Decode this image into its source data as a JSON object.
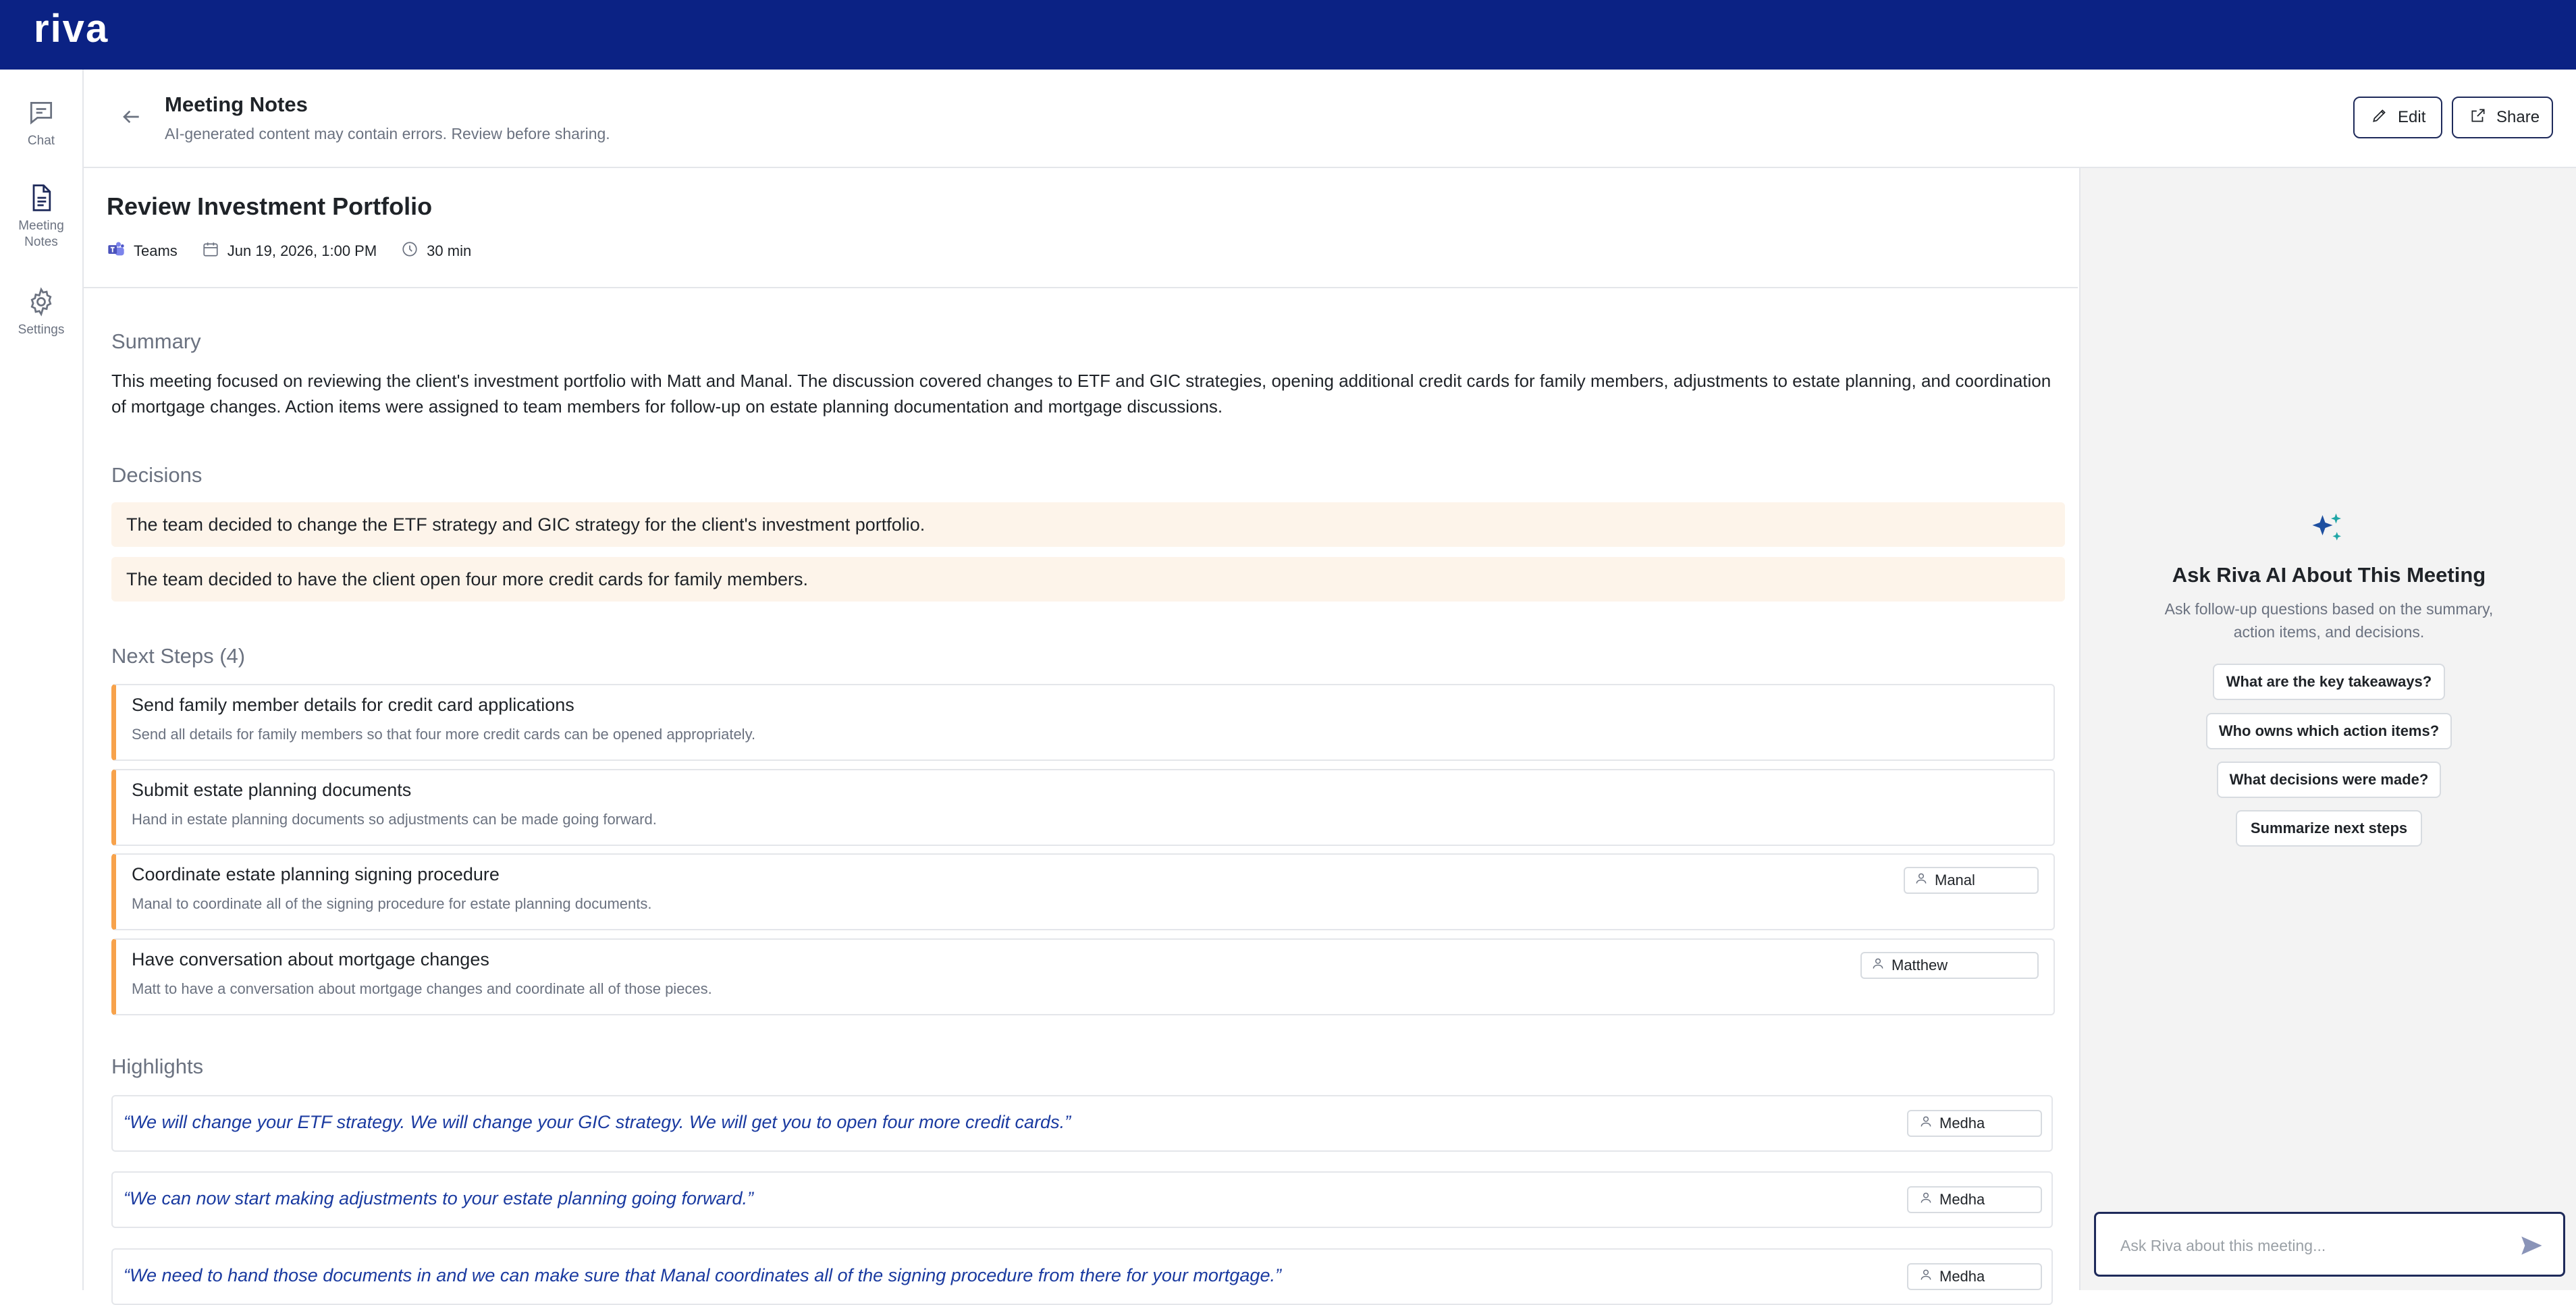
{
  "brand": {
    "logo_text": "riva",
    "bar_color": "#0b2284"
  },
  "sidebar": {
    "items": [
      {
        "label": "Chat",
        "icon": "chat-icon"
      },
      {
        "label": "Meeting Notes",
        "icon": "document-icon"
      },
      {
        "label": "Settings",
        "icon": "gear-icon"
      }
    ]
  },
  "header": {
    "title": "Meeting Notes",
    "subtitle": "AI-generated content may contain errors. Review before sharing.",
    "edit_label": "Edit",
    "share_label": "Share"
  },
  "meeting": {
    "title": "Review Investment Portfolio",
    "platform": "Teams",
    "date": "Jun 19, 2026, 1:00 PM",
    "duration": "30 min"
  },
  "summary": {
    "title": "Summary",
    "text": "This meeting focused on reviewing the client's investment portfolio with Matt and Manal. The discussion covered changes to ETF and GIC strategies, opening additional credit cards for family members, adjustments to estate planning, and coordination of mortgage changes. Action items were assigned to team members for follow-up on estate planning documentation and mortgage discussions."
  },
  "decisions": {
    "title": "Decisions",
    "items": [
      "The team decided to change the ETF strategy and GIC strategy for the client's investment portfolio.",
      "The team decided to have the client open four more credit cards for family members."
    ]
  },
  "next_steps": {
    "title": "Next Steps (4)",
    "items": [
      {
        "title": "Send family member details for credit card applications",
        "desc": "Send all details for family members so that four more credit cards can be opened appropriately.",
        "assignee": ""
      },
      {
        "title": "Submit estate planning documents",
        "desc": "Hand in estate planning documents so adjustments can be made going forward.",
        "assignee": ""
      },
      {
        "title": "Coordinate estate planning signing procedure",
        "desc": "Manal to coordinate all of the signing procedure for estate planning documents.",
        "assignee": "Manal"
      },
      {
        "title": "Have conversation about mortgage changes",
        "desc": "Matt to have a conversation about mortgage changes and coordinate all of those pieces.",
        "assignee": "Matthew"
      }
    ]
  },
  "highlights": {
    "title": "Highlights",
    "items": [
      {
        "quote": "“We will change your ETF strategy. We will change your GIC strategy. We will get you to open four more credit cards.”",
        "speaker": "Medha"
      },
      {
        "quote": "“We can now start making adjustments to your estate planning going forward.”",
        "speaker": "Medha"
      },
      {
        "quote": "“We need to hand those documents in and we can make sure that Manal coordinates all of the signing procedure from there for your mortgage.”",
        "speaker": "Medha"
      }
    ]
  },
  "ask_panel": {
    "title": "Ask Riva AI About This Meeting",
    "subtitle": "Ask follow-up questions based on the summary, action items, and decisions.",
    "suggestions": [
      "What are the key takeaways?",
      "Who owns which action items?",
      "What decisions were made?",
      "Summarize next steps"
    ],
    "input_placeholder": "Ask Riva about this meeting...",
    "input_value": ""
  }
}
